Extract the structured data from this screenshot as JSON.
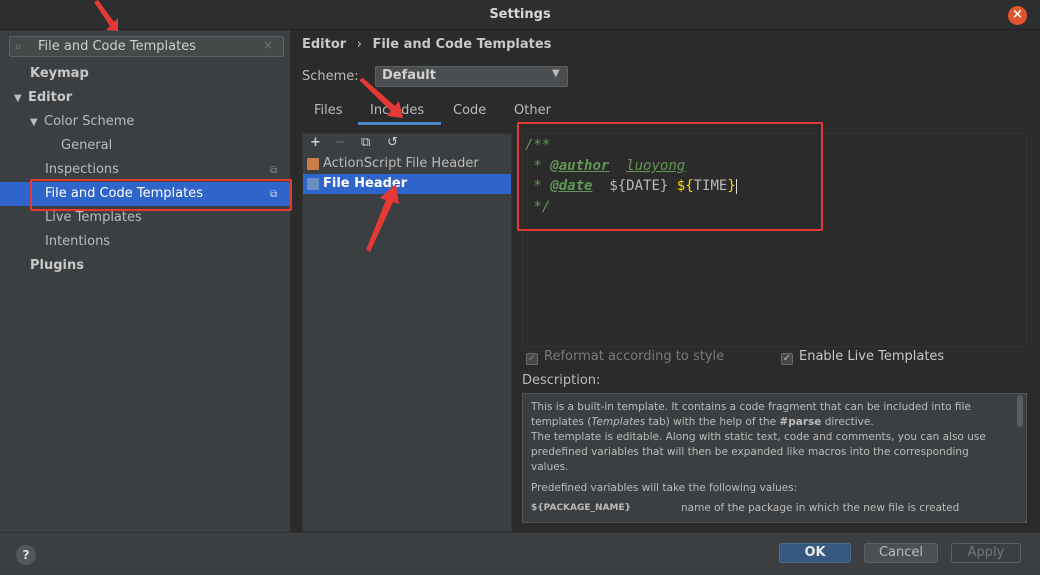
{
  "window": {
    "title": "Settings",
    "close_glyph": "×"
  },
  "search": {
    "value": "File and Code Templates",
    "clear_glyph": "×",
    "icon": "search-icon"
  },
  "tree": {
    "keymap": "Keymap",
    "editor": "Editor",
    "color_scheme": "Color Scheme",
    "general": "General",
    "inspections": "Inspections",
    "file_and_code_templates": "File and Code Templates",
    "live_templates": "Live Templates",
    "intentions": "Intentions",
    "plugins": "Plugins"
  },
  "breadcrumb": {
    "parent": "Editor",
    "separator": "›",
    "current": "File and Code Templates"
  },
  "scheme": {
    "label": "Scheme:",
    "value": "Default"
  },
  "tabs": [
    {
      "label": "Files",
      "selected": false
    },
    {
      "label": "Includes",
      "selected": true
    },
    {
      "label": "Code",
      "selected": false
    },
    {
      "label": "Other",
      "selected": false
    }
  ],
  "list_toolbar": {
    "add": "+",
    "remove": "−",
    "copy": "⧉",
    "reset": "↺"
  },
  "templates": [
    {
      "label": "ActionScript File Header",
      "selected": false
    },
    {
      "label": "File Header",
      "selected": true
    }
  ],
  "editor_code": {
    "line1": "/**",
    "line2_prefix": " * ",
    "author_tag": "@author",
    "author_value": "luoyong",
    "line3_prefix": " * ",
    "date_tag": "@date",
    "date_var_open": "${",
    "date_var_name": "DATE",
    "date_var_close": "}",
    "time_var_open": "${",
    "time_var_name": "TIME",
    "time_var_close": "}",
    "line4": " */"
  },
  "options": {
    "reformat_label": "Reformat according to style",
    "reformat_checked": true,
    "reformat_enabled": false,
    "live_templates_label": "Enable Live Templates",
    "live_templates_checked": true
  },
  "description": {
    "label": "Description:",
    "p1_a": "This is a built-in template. It contains a code fragment that can be included into file templates (",
    "p1_italic": "Templates",
    "p1_b": " tab) with the help of the ",
    "p1_bold": "#parse",
    "p1_c": " directive.",
    "p2": "The template is editable. Along with static text, code and comments, you can also use predefined variables that will then be expanded like macros into the corresponding values.",
    "p3": "Predefined variables will take the following values:",
    "var_name": "${PACKAGE_NAME}",
    "var_desc": "name of the package in which the new file is created"
  },
  "footer": {
    "help": "?",
    "ok": "OK",
    "cancel": "Cancel",
    "apply": "Apply"
  },
  "colors": {
    "selection": "#2f65ca",
    "annotation_red": "#e53935",
    "ok_button": "#365880"
  }
}
